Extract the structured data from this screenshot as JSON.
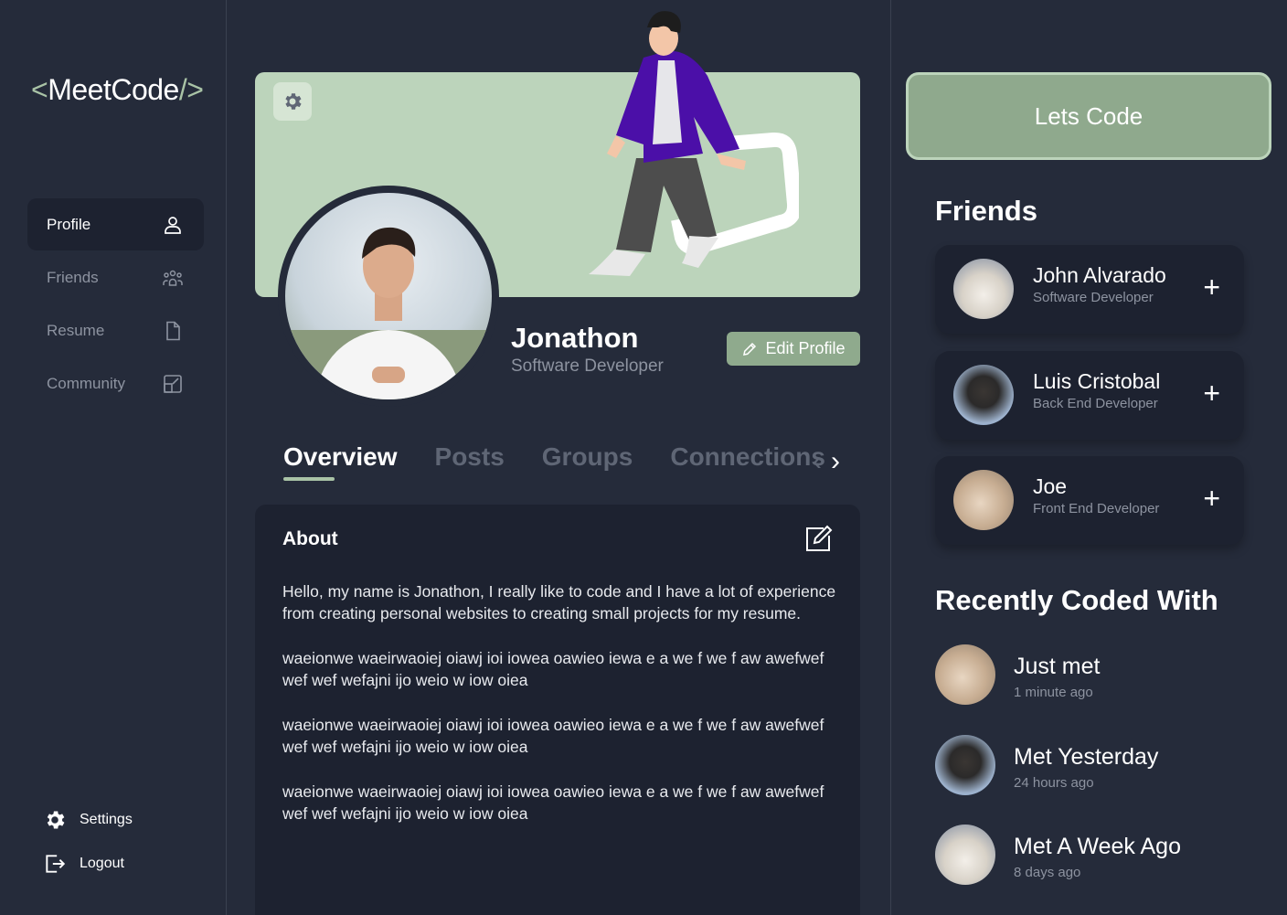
{
  "sidebar": {
    "logo": {
      "open": "<",
      "name": "MeetCode",
      "close": "/>"
    },
    "items": [
      {
        "label": "Profile",
        "icon": "user-icon"
      },
      {
        "label": "Friends",
        "icon": "group-icon"
      },
      {
        "label": "Resume",
        "icon": "document-icon"
      },
      {
        "label": "Community",
        "icon": "community-icon"
      }
    ],
    "settings_label": "Settings",
    "logout_label": "Logout"
  },
  "profile": {
    "name": "Jonathon",
    "role": "Software Developer",
    "edit_label": "Edit Profile",
    "tabs": [
      "Overview",
      "Posts",
      "Groups",
      "Connections"
    ]
  },
  "about": {
    "title": "About",
    "paragraphs": [
      "Hello, my name is Jonathon, I really like to code and I have a lot of experience from creating personal websites to creating small projects for my resume.",
      "waeionwe waeirwaoiej oiawj ioi  iowea oawieo iewa e a we f we f aw awefwef wef wef wefajni  ijo weio w iow oiea",
      "waeionwe waeirwaoiej oiawj ioi  iowea oawieo iewa e a we f we f aw awefwef wef wef wefajni  ijo weio w iow oiea",
      "waeionwe waeirwaoiej oiawj ioi  iowea oawieo iewa e a we f we f aw awefwef wef wef wefajni  ijo weio w iow oiea"
    ]
  },
  "right": {
    "cta_label": "Lets Code",
    "friends_title": "Friends",
    "friends": [
      {
        "name": "John Alvarado",
        "role": "Software Developer",
        "avatar": "dog"
      },
      {
        "name": "Luis Cristobal",
        "role": "Back End Developer",
        "avatar": "man"
      },
      {
        "name": "Joe",
        "role": "Front End Developer",
        "avatar": "cat"
      }
    ],
    "recent_title": "Recently Coded With",
    "recent": [
      {
        "label": "Just met",
        "time": "1 minute ago",
        "avatar": "cat"
      },
      {
        "label": "Met Yesterday",
        "time": "24 hours ago",
        "avatar": "man"
      },
      {
        "label": "Met A Week Ago",
        "time": "8 days ago",
        "avatar": "dog"
      }
    ]
  },
  "colors": {
    "background": "#252b3a",
    "card": "#1d2230",
    "accent": "#8faa8d",
    "banner": "#bcd4bb",
    "muted": "#8d93a0"
  }
}
